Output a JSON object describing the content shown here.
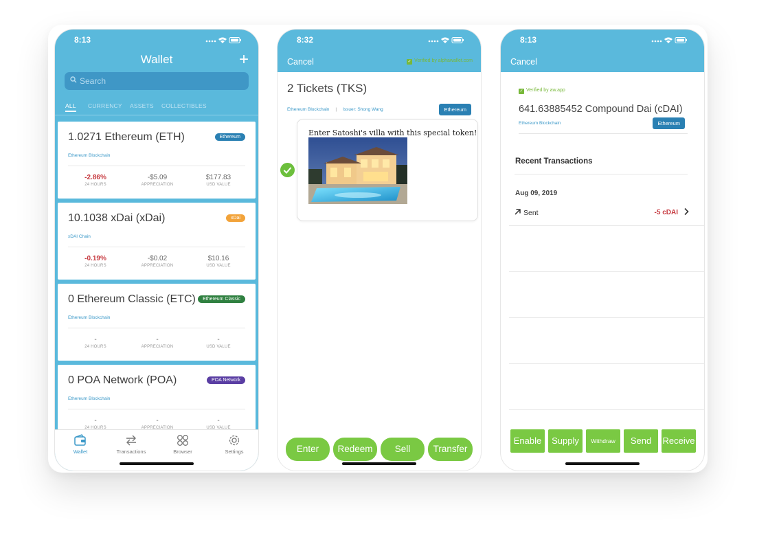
{
  "screens": {
    "wallet": {
      "time": "8:13",
      "title": "Wallet",
      "add_label": "+",
      "search_placeholder": "Search",
      "filter_tabs": [
        {
          "label": "ALL",
          "active": true
        },
        {
          "label": "CURRENCY",
          "active": false
        },
        {
          "label": "ASSETS",
          "active": false
        },
        {
          "label": "COLLECTIBLES",
          "active": false
        }
      ],
      "tokens": [
        {
          "name": "1.0271 Ethereum (ETH)",
          "badge": "Ethereum",
          "badge_color": "#2a80b3",
          "chain": "Ethereum Blockchain",
          "change": "-2.86%",
          "change_label": "24 HOURS",
          "appreciation": "-$5.09",
          "appreciation_label": "APPRECIATION",
          "value": "$177.83",
          "value_label": "USD VALUE"
        },
        {
          "name": "10.1038 xDai (xDai)",
          "badge": "xDai",
          "badge_color": "#f2a33a",
          "chain": "xDAI Chain",
          "change": "-0.19%",
          "change_label": "24 HOURS",
          "appreciation": "-$0.02",
          "appreciation_label": "APPRECIATION",
          "value": "$10.16",
          "value_label": "USD VALUE"
        },
        {
          "name": "0 Ethereum Classic (ETC)",
          "badge": "Ethereum Classic",
          "badge_color": "#2f8040",
          "chain": "Ethereum Blockchain",
          "change": "-",
          "change_label": "24 HOURS",
          "appreciation": "-",
          "appreciation_label": "APPRECIATION",
          "value": "-",
          "value_label": "USD VALUE"
        },
        {
          "name": "0 POA Network (POA)",
          "badge": "POA Network",
          "badge_color": "#5a3ea3",
          "chain": "Ethereum Blockchain",
          "change": "-",
          "change_label": "24 HOURS",
          "appreciation": "-",
          "appreciation_label": "APPRECIATION",
          "value": "-",
          "value_label": "USD VALUE"
        }
      ],
      "nav": [
        {
          "label": "Wallet",
          "icon": "wallet-icon",
          "active": true
        },
        {
          "label": "Transactions",
          "icon": "transactions-icon",
          "active": false
        },
        {
          "label": "Browser",
          "icon": "browser-icon",
          "active": false
        },
        {
          "label": "Settings",
          "icon": "settings-icon",
          "active": false
        }
      ]
    },
    "ticket": {
      "time": "8:32",
      "cancel": "Cancel",
      "verified": "Verified by alphawallet.com",
      "title": "2 Tickets (TKS)",
      "chain": "Ethereum Blockchain",
      "issuer": "Issuer: Shong Wang",
      "badge": "Ethereum",
      "description": "Enter Satoshi's villa with this special token!",
      "actions": [
        "Enter",
        "Redeem",
        "Sell",
        "Transfer"
      ]
    },
    "token": {
      "time": "8:13",
      "cancel": "Cancel",
      "verified": "Verified by aw.app",
      "name": "641.63885452 Compound Dai (cDAI)",
      "chain": "Ethereum Blockchain",
      "badge": "Ethereum",
      "recent_title": "Recent Transactions",
      "date": "Aug 09, 2019",
      "tx_type": "Sent",
      "tx_amount": "-5 cDAI",
      "actions": [
        "Enable",
        "Supply",
        "Withdraw",
        "Send",
        "Receive"
      ]
    }
  },
  "colors": {
    "header_blue": "#5ab9dc",
    "action_green": "#7ac943",
    "negative_red": "#c6383e",
    "link_blue": "#3a98c8"
  }
}
